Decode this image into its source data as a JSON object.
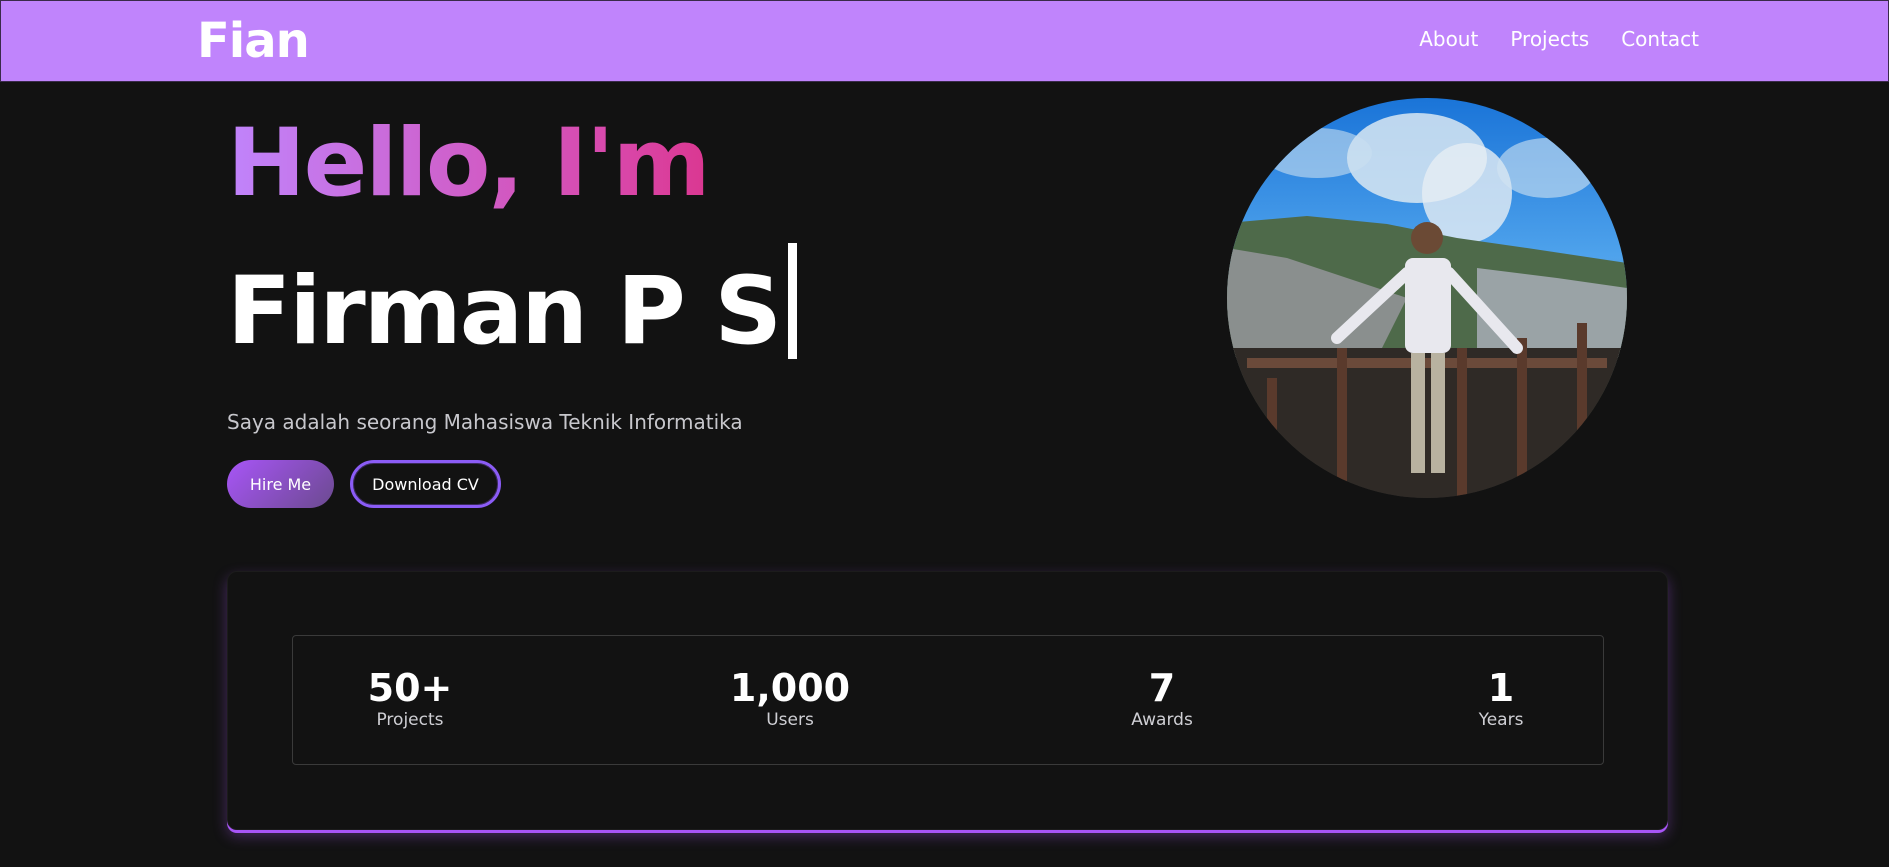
{
  "navbar": {
    "brand": "Fian",
    "links": [
      "About",
      "Projects",
      "Contact"
    ]
  },
  "hero": {
    "greeting": "Hello, I'm",
    "name": "Firman P S",
    "tagline": "Saya adalah seorang Mahasiswa Teknik Informatika",
    "buttons": {
      "hire": "Hire Me",
      "cv": "Download CV"
    }
  },
  "stats": [
    {
      "value": "50+",
      "label": "Projects"
    },
    {
      "value": "1,000",
      "label": "Users"
    },
    {
      "value": "7",
      "label": "Awards"
    },
    {
      "value": "1",
      "label": "Years"
    }
  ],
  "colors": {
    "navbar_bg": "#c084fc",
    "page_bg": "#121212",
    "accent": "#a855f7",
    "greeting_gradient_start": "#c084fc",
    "greeting_gradient_end": "#db2777"
  }
}
